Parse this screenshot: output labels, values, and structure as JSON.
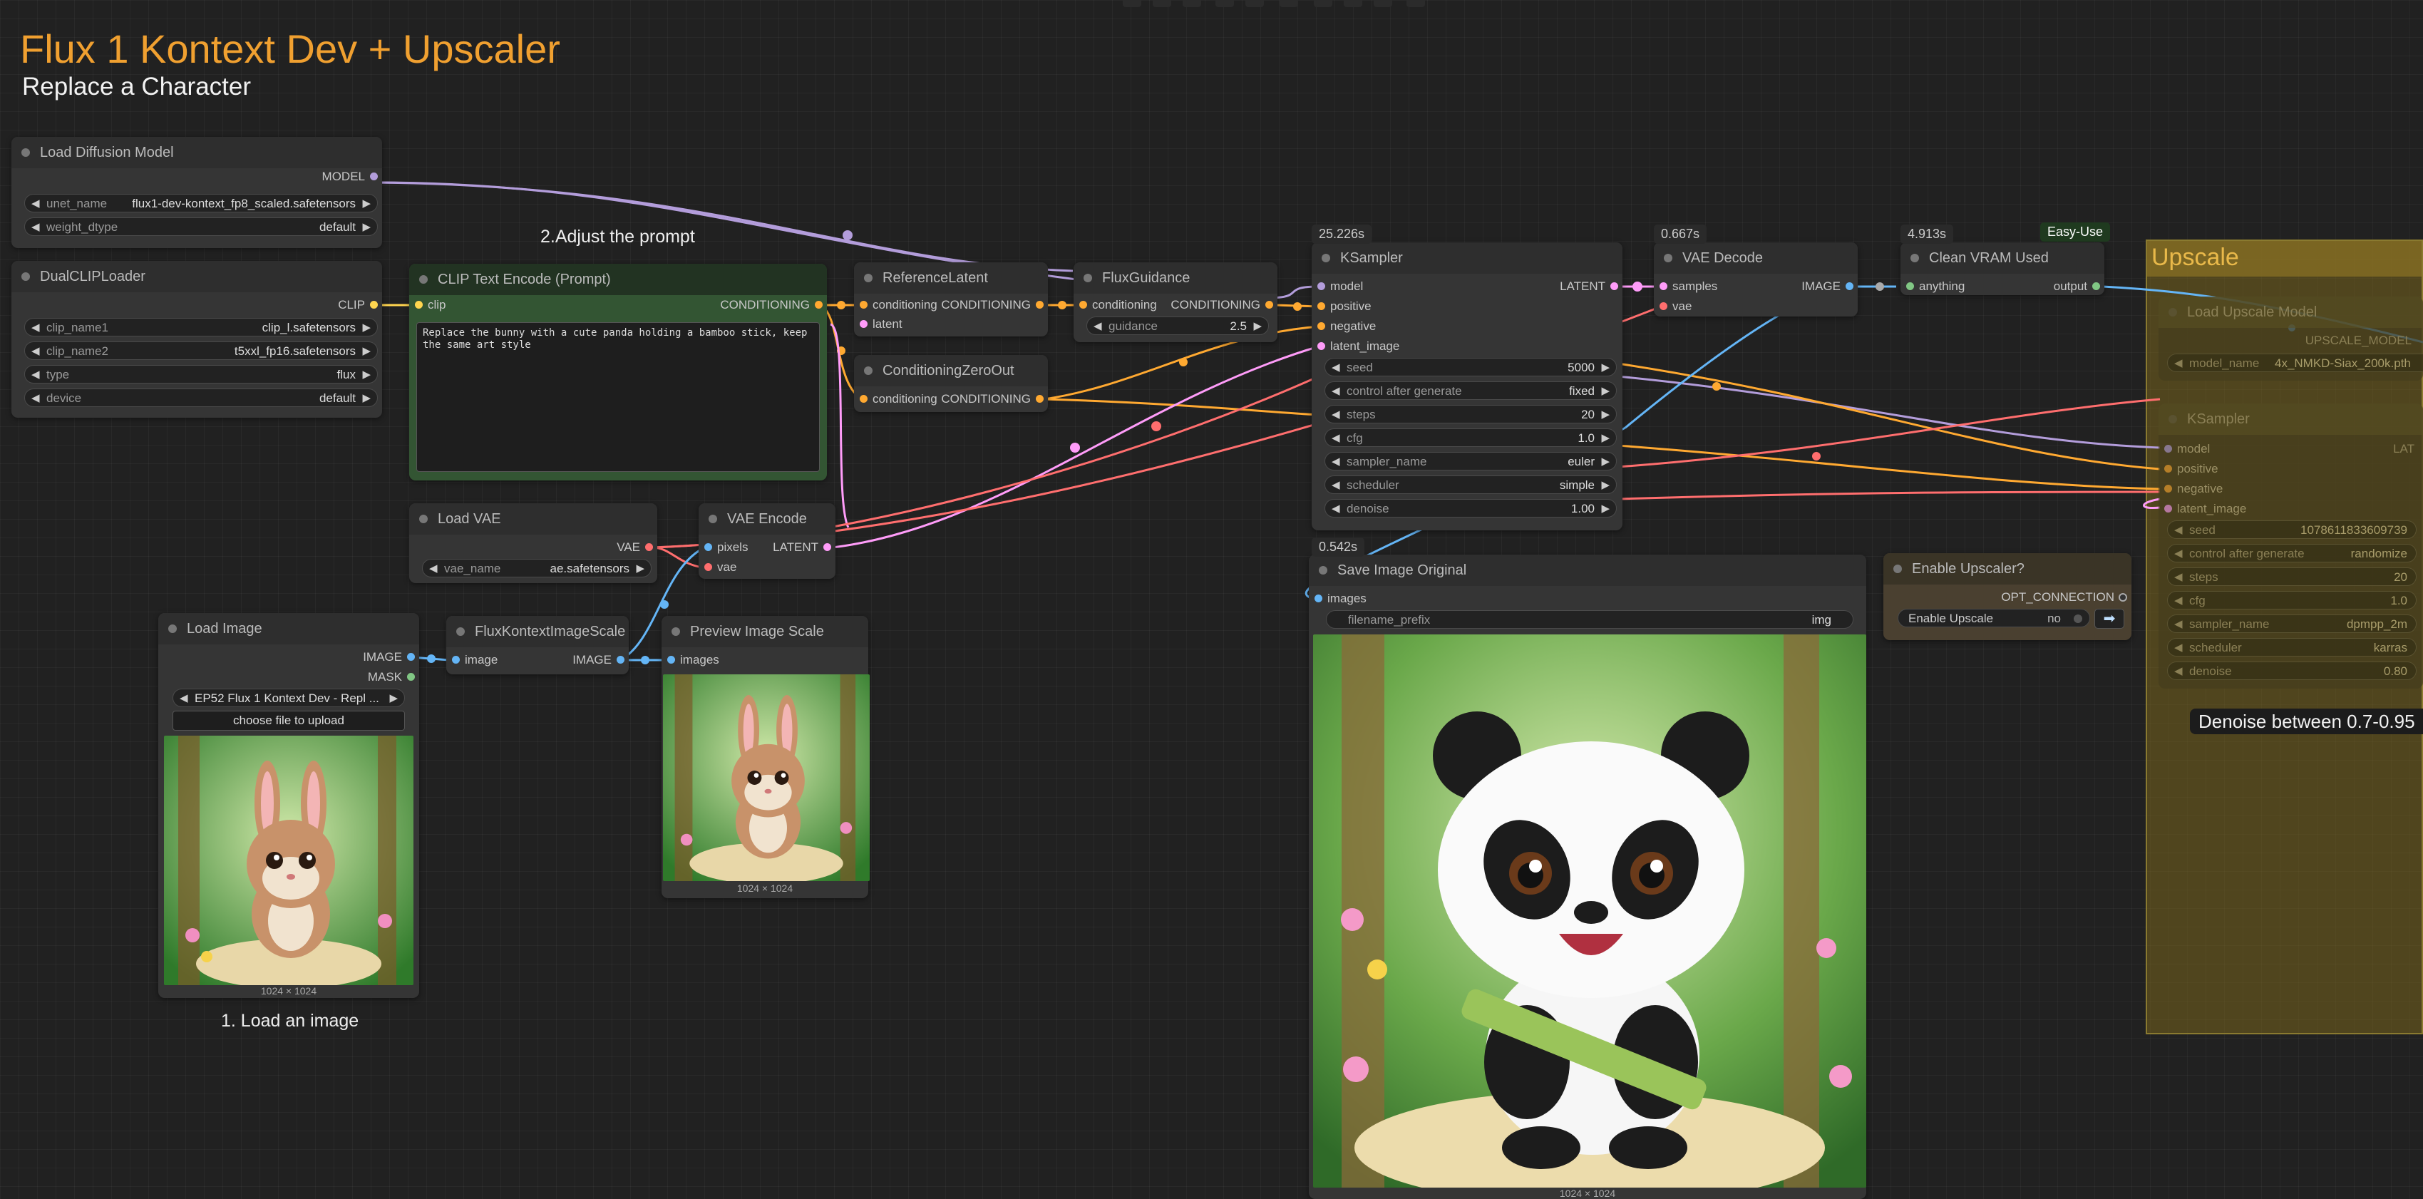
{
  "header": {
    "title": "Flux 1 Kontext Dev + Upscaler",
    "subtitle": "Replace a Character"
  },
  "notes": {
    "adjust_prompt": "2.Adjust the prompt",
    "load_image": "1. Load an image",
    "denoise": "Denoise between 0.7-0.95"
  },
  "colors": {
    "model": "#b39ddb",
    "clip": "#ffd54f",
    "conditioning": "#ffa931",
    "latent": "#ff9cf9",
    "vae": "#ff6e6e",
    "image": "#64b5f6",
    "title_accent": "#f0a030",
    "upscale_group": "#6a5a1e"
  },
  "nodes": {
    "load_diffusion": {
      "title": "Load Diffusion Model",
      "out_model": "MODEL",
      "unet_name_label": "unet_name",
      "unet_name_value": "flux1-dev-kontext_fp8_scaled.safetensors",
      "weight_dtype_label": "weight_dtype",
      "weight_dtype_value": "default"
    },
    "dual_clip": {
      "title": "DualCLIPLoader",
      "out_clip": "CLIP",
      "clip_name1_label": "clip_name1",
      "clip_name1_value": "clip_l.safetensors",
      "clip_name2_label": "clip_name2",
      "clip_name2_value": "t5xxl_fp16.safetensors",
      "type_label": "type",
      "type_value": "flux",
      "device_label": "device",
      "device_value": "default"
    },
    "clip_text": {
      "title": "CLIP Text Encode (Prompt)",
      "in_clip": "clip",
      "out_cond": "CONDITIONING",
      "prompt": "Replace the bunny with a cute panda holding a bamboo stick, keep the same art style"
    },
    "reference_latent": {
      "title": "ReferenceLatent",
      "in_cond": "conditioning",
      "in_latent": "latent",
      "out_cond": "CONDITIONING"
    },
    "cond_zero": {
      "title": "ConditioningZeroOut",
      "in_cond": "conditioning",
      "out_cond": "CONDITIONING"
    },
    "flux_guidance": {
      "title": "FluxGuidance",
      "in_cond": "conditioning",
      "out_cond": "CONDITIONING",
      "guidance_label": "guidance",
      "guidance_value": "2.5"
    },
    "ksampler": {
      "timing": "25.226s",
      "title": "KSampler",
      "in_model": "model",
      "in_positive": "positive",
      "in_negative": "negative",
      "in_latent": "latent_image",
      "out_latent": "LATENT",
      "widgets": [
        {
          "label": "seed",
          "value": "5000"
        },
        {
          "label": "control after generate",
          "value": "fixed"
        },
        {
          "label": "steps",
          "value": "20"
        },
        {
          "label": "cfg",
          "value": "1.0"
        },
        {
          "label": "sampler_name",
          "value": "euler"
        },
        {
          "label": "scheduler",
          "value": "simple"
        },
        {
          "label": "denoise",
          "value": "1.00"
        }
      ]
    },
    "vae_decode": {
      "timing": "0.667s",
      "title": "VAE Decode",
      "in_samples": "samples",
      "in_vae": "vae",
      "out_image": "IMAGE"
    },
    "clean_vram": {
      "timing": "4.913s",
      "badge": "Easy-Use",
      "title": "Clean VRAM Used",
      "in_anything": "anything",
      "out_output": "output"
    },
    "load_vae": {
      "title": "Load VAE",
      "out_vae": "VAE",
      "vae_name_label": "vae_name",
      "vae_name_value": "ae.safetensors"
    },
    "vae_encode": {
      "title": "VAE Encode",
      "in_pixels": "pixels",
      "in_vae": "vae",
      "out_latent": "LATENT"
    },
    "load_image": {
      "title": "Load Image",
      "out_image": "IMAGE",
      "out_mask": "MASK",
      "image_value": "EP52 Flux 1 Kontext Dev - Repl ...",
      "upload_label": "choose file to upload",
      "caption": "1024 × 1024"
    },
    "flux_scale": {
      "title": "FluxKontextImageScale",
      "in_image": "image",
      "out_image": "IMAGE"
    },
    "preview_scale": {
      "title": "Preview Image Scale",
      "in_images": "images",
      "caption": "1024 × 1024"
    },
    "save_image": {
      "timing": "0.542s",
      "title": "Save Image Original",
      "in_images": "images",
      "prefix_label": "filename_prefix",
      "prefix_value": "img",
      "caption": "1024 × 1024"
    },
    "enable_upscaler": {
      "title": "Enable Upscaler?",
      "out_opt": "OPT_CONNECTION",
      "toggle_label": "Enable Upscale",
      "toggle_value": "no"
    },
    "upscale_group": {
      "title": "Upscale",
      "load_upscale_title": "Load Upscale Model",
      "upscale_model_out": "UPSCALE_MODEL",
      "model_name_label": "model_name",
      "model_name_value": "4x_NMKD-Siax_200k.pth",
      "ks_title": "KSampler",
      "ks_out": "LAT",
      "ks_inputs": [
        "model",
        "positive",
        "negative",
        "latent_image"
      ],
      "ks_widgets": [
        {
          "label": "seed",
          "value": "1078611833609739"
        },
        {
          "label": "control after generate",
          "value": "randomize"
        },
        {
          "label": "steps",
          "value": "20"
        },
        {
          "label": "cfg",
          "value": "1.0"
        },
        {
          "label": "sampler_name",
          "value": "dpmpp_2m"
        },
        {
          "label": "scheduler",
          "value": "karras"
        },
        {
          "label": "denoise",
          "value": "0.80"
        }
      ]
    }
  }
}
